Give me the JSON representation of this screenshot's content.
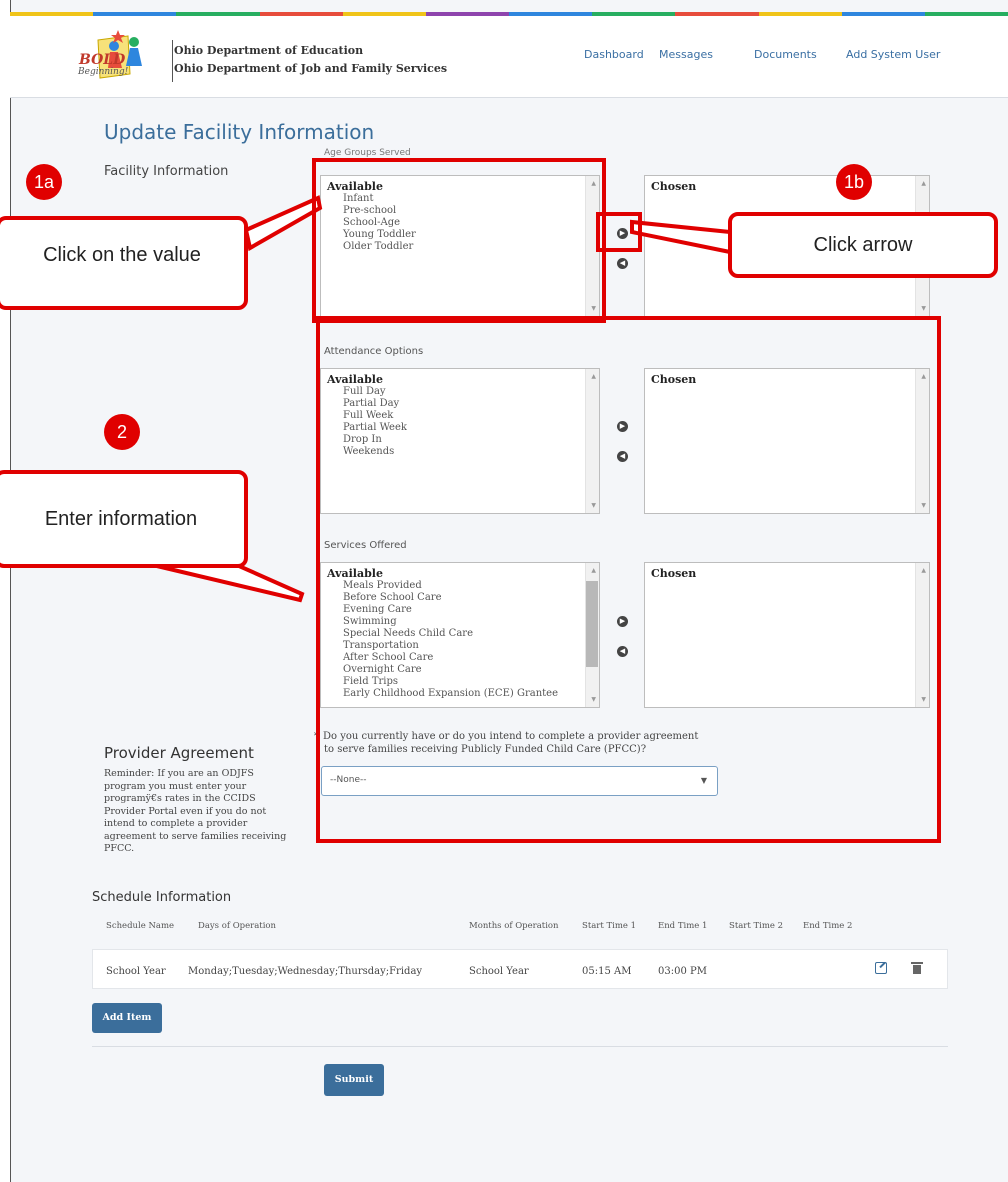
{
  "header": {
    "agency_1": "Ohio Department of Education",
    "agency_2": "Ohio Department of Job and Family Services",
    "logo_text": "BOLD",
    "logo_sub": "Beginning!",
    "nav": [
      "Dashboard",
      "Messages",
      "Documents",
      "Add System User"
    ],
    "colorbar": [
      "#f0c419",
      "#2e86de",
      "#27ae60",
      "#e74c3c",
      "#f0c419",
      "#8e44ad",
      "#2e86de",
      "#27ae60",
      "#e74c3c",
      "#f0c419",
      "#2e86de",
      "#27ae60"
    ]
  },
  "page": {
    "title": "Update Facility Information",
    "section": "Facility Information"
  },
  "age_groups": {
    "label": "Age Groups Served",
    "available_header": "Available",
    "chosen_header": "Chosen",
    "options": [
      "Infant",
      "Pre-school",
      "School-Age",
      "Young Toddler",
      "Older Toddler"
    ]
  },
  "attendance": {
    "label": "Attendance Options",
    "available_header": "Available",
    "chosen_header": "Chosen",
    "options": [
      "Full Day",
      "Partial Day",
      "Full Week",
      "Partial Week",
      "Drop In",
      "Weekends"
    ]
  },
  "services": {
    "label": "Services Offered",
    "available_header": "Available",
    "chosen_header": "Chosen",
    "options": [
      "Meals Provided",
      "Before School Care",
      "Evening Care",
      "Swimming",
      "Special Needs Child Care",
      "Transportation",
      "After School Care",
      "Overnight Care",
      "Field Trips",
      "Early Childhood Expansion (ECE) Grantee"
    ]
  },
  "pfcc": {
    "question_1": "Do you currently have or do you intend to complete a provider agreement",
    "question_2": "to serve families receiving Publicly Funded Child Care (PFCC)?",
    "required_mark": "*",
    "select_value": "--None--"
  },
  "provider_agreement": {
    "title": "Provider Agreement",
    "reminder": "Reminder: If you are an ODJFS program you must enter your programÿ€s rates in the CCIDS Provider Portal even if you do not intend to complete a provider agreement to serve families receiving PFCC."
  },
  "schedule": {
    "title": "Schedule Information",
    "columns": [
      "Schedule Name",
      "Days of Operation",
      "Months of Operation",
      "Start Time 1",
      "End Time 1",
      "Start Time 2",
      "End Time 2"
    ],
    "row": [
      "School Year",
      "Monday;Tuesday;Wednesday;Thursday;Friday",
      "School Year",
      "05:15 AM",
      "03:00 PM",
      "",
      ""
    ]
  },
  "buttons": {
    "add_item": "Add Item",
    "submit": "Submit"
  },
  "annotations": {
    "badge_1a": "1a",
    "badge_1b": "1b",
    "badge_2": "2",
    "callout_click_value": "Click on the value",
    "callout_click_arrow": "Click arrow",
    "callout_enter_info": "Enter information"
  }
}
